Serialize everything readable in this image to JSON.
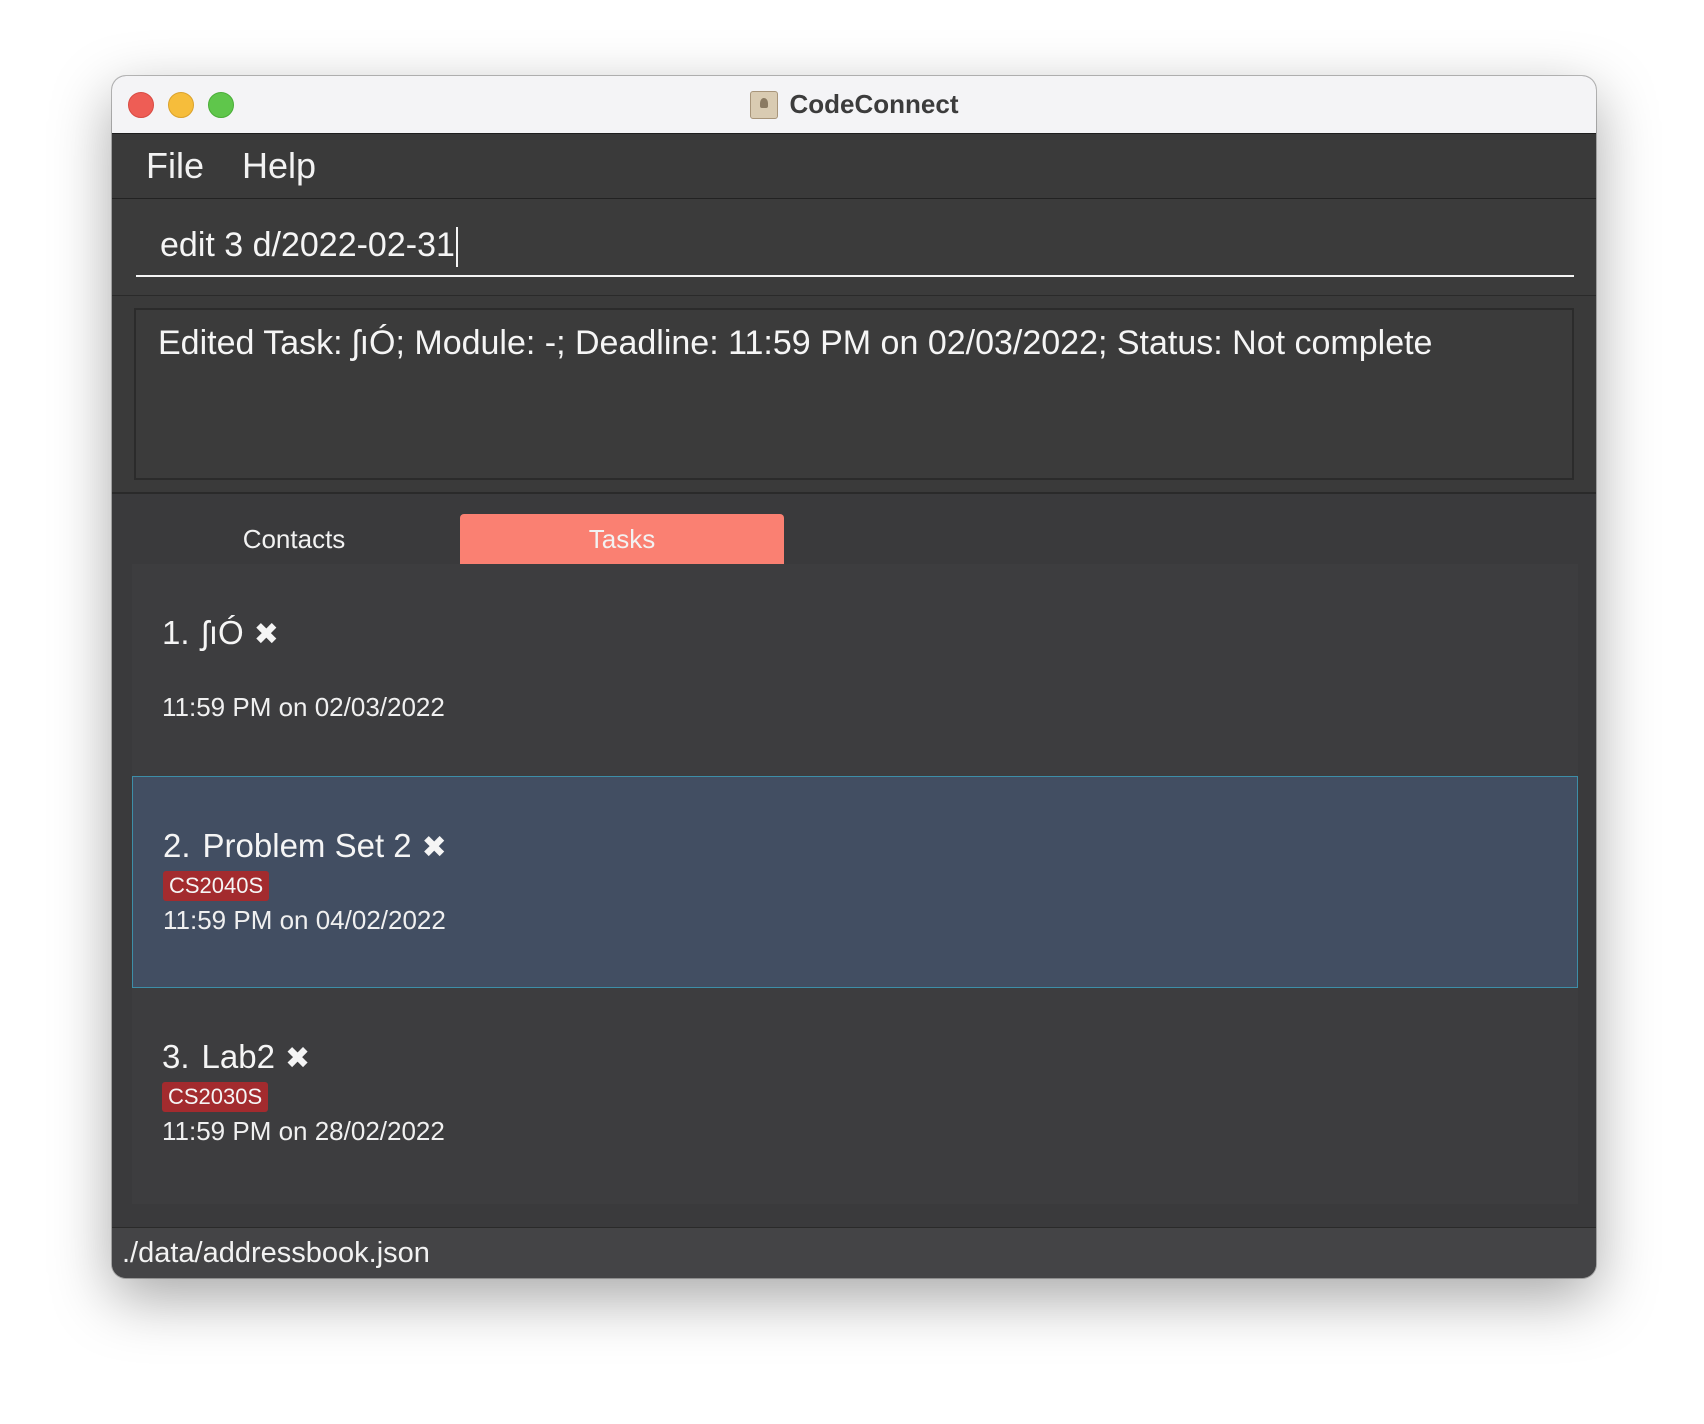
{
  "window": {
    "title": "CodeConnect"
  },
  "menu": {
    "file": "File",
    "help": "Help"
  },
  "command": {
    "value": "edit 3 d/2022-02-31"
  },
  "result": {
    "text": "Edited Task: ʃıÓ; Module: -; Deadline: 11:59 PM on 02/03/2022; Status: Not complete"
  },
  "tabs": [
    {
      "label": "Contacts",
      "active": false
    },
    {
      "label": "Tasks",
      "active": true
    }
  ],
  "tasks": [
    {
      "index": "1.",
      "name": "ʃıÓ",
      "status_icon": "✖",
      "module": "",
      "deadline": "11:59 PM on 02/03/2022"
    },
    {
      "index": "2.",
      "name": "Problem Set 2",
      "status_icon": "✖",
      "module": "CS2040S",
      "deadline": "11:59 PM on 04/02/2022"
    },
    {
      "index": "3.",
      "name": "Lab2",
      "status_icon": "✖",
      "module": "CS2030S",
      "deadline": "11:59 PM on 28/02/2022"
    }
  ],
  "status_bar": {
    "path": "./data/addressbook.json"
  },
  "colors": {
    "active_tab": "#fa8072",
    "tag_bg": "#a32b2e",
    "selected_card": "#424e62",
    "selected_border": "#3d8ea8"
  }
}
